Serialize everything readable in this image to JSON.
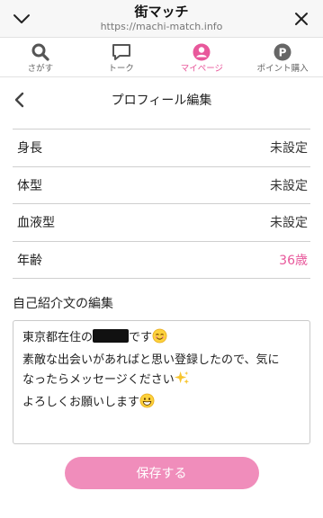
{
  "browser": {
    "title": "街マッチ",
    "url": "https://machi-match.info",
    "collapse_icon": "chevron-down-icon",
    "close_icon": "close-icon"
  },
  "tabs": [
    {
      "label": "さがす",
      "icon": "search-icon",
      "active": false
    },
    {
      "label": "トーク",
      "icon": "chat-bubble-icon",
      "active": false
    },
    {
      "label": "マイページ",
      "icon": "user-icon",
      "active": true
    },
    {
      "label": "ポイント購入",
      "icon": "points-icon",
      "active": false
    }
  ],
  "header": {
    "title": "プロフィール編集",
    "back_icon": "chevron-left-icon"
  },
  "profile_rows": [
    {
      "label": "身長",
      "value": "未設定"
    },
    {
      "label": "体型",
      "value": "未設定"
    },
    {
      "label": "血液型",
      "value": "未設定"
    },
    {
      "label": "年齢",
      "value": "36歳"
    }
  ],
  "intro": {
    "section_label": "自己紹介文の編集",
    "line1_prefix": "東京都在住の",
    "line1_suffix": "です",
    "line2": "素敵な出会いがあればと思い登録したので、気に",
    "line3": "なったらメッセージください",
    "line4": "よろしくお願いします"
  },
  "save_label": "保存する",
  "colors": {
    "accent_pink": "#e8589b",
    "button_pink": "#f08dbb"
  }
}
